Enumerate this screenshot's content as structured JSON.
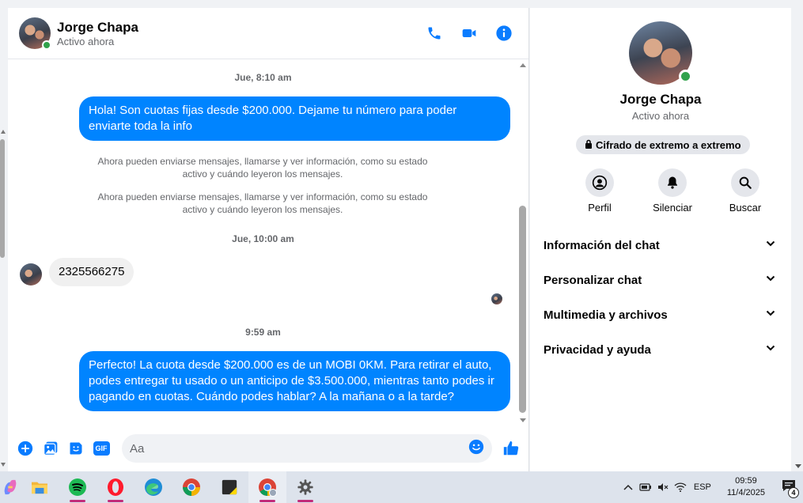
{
  "chat": {
    "contact_name": "Jorge Chapa",
    "contact_status": "Activo ahora",
    "header_icons": [
      "phone-icon",
      "video-icon",
      "info-icon"
    ],
    "messages": [
      {
        "type": "timestamp",
        "text": "Jue, 8:10 am"
      },
      {
        "type": "outgoing",
        "text": "Hola! Son cuotas fijas desde $200.000. Dejame tu número para poder enviarte toda la info"
      },
      {
        "type": "system",
        "text": "Ahora pueden enviarse mensajes, llamarse y ver información, como su estado activo y cuándo leyeron los mensajes."
      },
      {
        "type": "system",
        "text": "Ahora pueden enviarse mensajes, llamarse y ver información, como su estado activo y cuándo leyeron los mensajes."
      },
      {
        "type": "timestamp",
        "text": "Jue, 10:00 am"
      },
      {
        "type": "incoming",
        "text": "2325566275"
      },
      {
        "type": "timestamp",
        "text": "9:59 am"
      },
      {
        "type": "outgoing",
        "text": "Perfecto! La cuota desde $200.000 es de un MOBI 0KM. Para retirar el auto, podes entregar tu usado o un anticipo de $3.500.000, mientras tanto podes ir pagando en cuotas. Cuándo podes hablar? A la mañana o a la tarde?"
      }
    ],
    "composer": {
      "placeholder": "Aa",
      "icons": [
        "plus-icon",
        "image-icon",
        "sticker-icon",
        "gif-icon",
        "emoji-icon",
        "like-icon"
      ],
      "gif_label": "GIF"
    }
  },
  "info_panel": {
    "name": "Jorge Chapa",
    "status": "Activo ahora",
    "encryption_label": "Cifrado de extremo a extremo",
    "actions": [
      {
        "label": "Perfil",
        "icon": "profile-icon"
      },
      {
        "label": "Silenciar",
        "icon": "bell-icon"
      },
      {
        "label": "Buscar",
        "icon": "search-icon"
      }
    ],
    "sections": [
      {
        "label": "Información del chat"
      },
      {
        "label": "Personalizar chat"
      },
      {
        "label": "Multimedia y archivos"
      },
      {
        "label": "Privacidad y ayuda"
      }
    ]
  },
  "taskbar": {
    "apps": [
      "copilot-icon",
      "file-explorer-icon",
      "spotify-icon",
      "opera-icon",
      "edge-icon",
      "chrome-icon",
      "sticky-notes-icon",
      "chrome-profile-icon",
      "settings-icon"
    ],
    "language": "ESP",
    "time": "09:59",
    "date": "11/4/2025",
    "notification_count": "4"
  },
  "colors": {
    "accent": "#0084ff",
    "online": "#31a24c",
    "icon_blue": "#0a7cff",
    "background": "#f0f2f5"
  }
}
